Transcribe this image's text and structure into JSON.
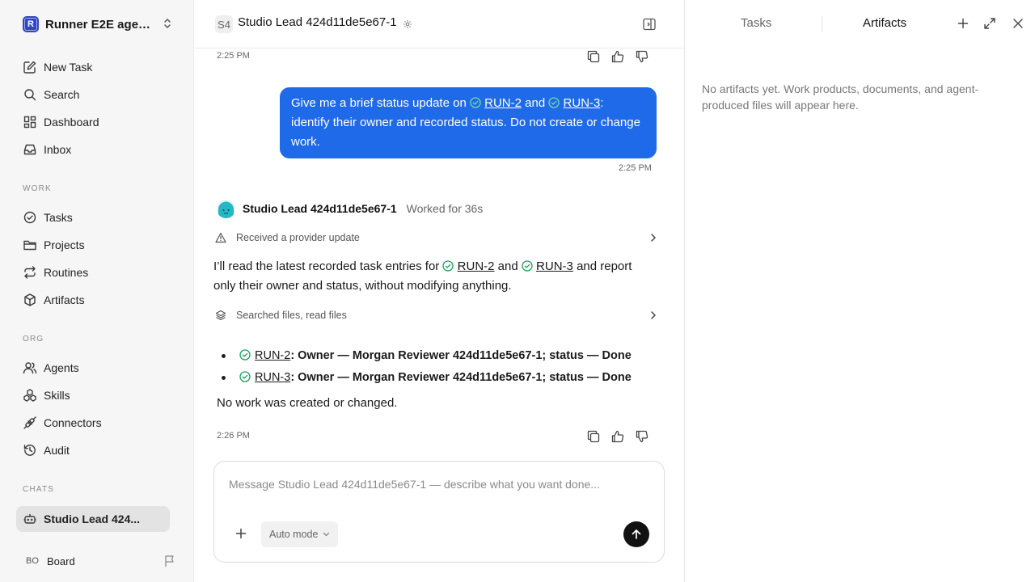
{
  "workspace": {
    "logo_text": "R",
    "name": "Runner E2E agen..."
  },
  "nav_main": [
    {
      "label": "New Task",
      "icon": "edit-icon"
    },
    {
      "label": "Search",
      "icon": "search-icon"
    },
    {
      "label": "Dashboard",
      "icon": "dashboard-icon"
    },
    {
      "label": "Inbox",
      "icon": "inbox-icon"
    }
  ],
  "sections": {
    "work": "WORK",
    "org": "ORG",
    "chats": "CHATS"
  },
  "nav_work": [
    {
      "label": "Tasks",
      "icon": "check-circle-icon"
    },
    {
      "label": "Projects",
      "icon": "folder-icon"
    },
    {
      "label": "Routines",
      "icon": "repeat-icon"
    },
    {
      "label": "Artifacts",
      "icon": "box-icon"
    }
  ],
  "nav_org": [
    {
      "label": "Agents",
      "icon": "users-icon"
    },
    {
      "label": "Skills",
      "icon": "skills-icon"
    },
    {
      "label": "Connectors",
      "icon": "plug-icon"
    },
    {
      "label": "Audit",
      "icon": "history-icon"
    }
  ],
  "chats": [
    {
      "label": "Studio Lead 424...",
      "icon": "bot-icon",
      "active": true
    }
  ],
  "board": {
    "initials": "BO",
    "name": "Board"
  },
  "header": {
    "badge": "S4",
    "title": "Studio Lead 424d11de5e67-1"
  },
  "messages": {
    "prev_time": "2:25 PM",
    "user": {
      "text_1": "Give me a brief status update on",
      "task_a": "RUN-2",
      "and": "and",
      "task_b": "RUN-3",
      "text_2": ":",
      "text_3": "identify their owner and recorded status. Do not create or change work.",
      "time": "2:25 PM"
    },
    "agent": {
      "name": "Studio Lead 424d11de5e67-1",
      "worked": "Worked for 36s",
      "provider_update": "Received a provider update",
      "intro_1": "I’ll read the latest recorded task entries for",
      "task_a": "RUN-2",
      "and": "and",
      "task_b": "RUN-3",
      "intro_2": "and report only their owner and status, without modifying anything.",
      "tool_summary": "Searched files, read files",
      "items": [
        {
          "task": "RUN-2",
          "text": ": Owner — Morgan Reviewer 424d11de5e67-1; status — ",
          "status": "Done"
        },
        {
          "task": "RUN-3",
          "text": ": Owner — Morgan Reviewer 424d11de5e67-1; status — ",
          "status": "Done"
        }
      ],
      "closing": "No work was created or changed.",
      "time": "2:26 PM"
    }
  },
  "composer": {
    "placeholder": "Message Studio Lead 424d11de5e67-1 — describe what you want done...",
    "mode": "Auto mode"
  },
  "right_panel": {
    "tabs": [
      "Tasks",
      "Artifacts"
    ],
    "active_tab": "Artifacts",
    "empty_message": "No artifacts yet. Work products, documents, and agent-produced files will appear here."
  },
  "colors": {
    "accent": "#1f6ae8",
    "success": "#1aa05a",
    "workspace_logo": "#3346c8"
  }
}
